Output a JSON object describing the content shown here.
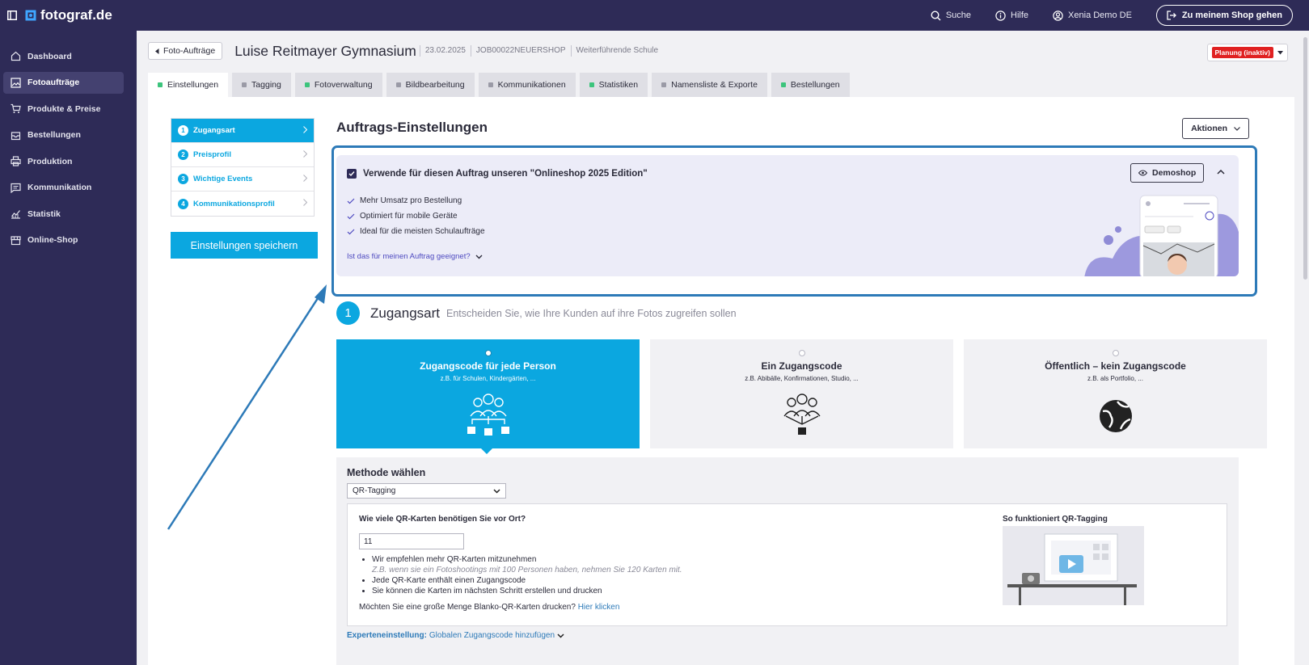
{
  "topbar": {
    "logo": "fotograf.de",
    "search": "Suche",
    "help": "Hilfe",
    "user": "Xenia Demo DE",
    "shop_button": "Zu meinem Shop gehen"
  },
  "sidebar": {
    "items": [
      {
        "label": "Dashboard",
        "icon": "home-icon"
      },
      {
        "label": "Fotoaufträge",
        "icon": "image-icon",
        "active": true
      },
      {
        "label": "Produkte & Preise",
        "icon": "cart-icon"
      },
      {
        "label": "Bestellungen",
        "icon": "inbox-icon"
      },
      {
        "label": "Produktion",
        "icon": "printer-icon"
      },
      {
        "label": "Kommunikation",
        "icon": "message-icon"
      },
      {
        "label": "Statistik",
        "icon": "chart-icon"
      },
      {
        "label": "Online-Shop",
        "icon": "store-icon"
      }
    ]
  },
  "header": {
    "back": "Foto-Aufträge",
    "title": "Luise Reitmayer Gymnasium",
    "date": "23.02.2025",
    "job_id": "JOB00022NEUERSHOP",
    "school_type": "Weiterführende Schule",
    "status": "Planung (inaktiv)"
  },
  "tabs": [
    {
      "label": "Einstellungen",
      "dot": "#3cc47c",
      "active": true
    },
    {
      "label": "Tagging",
      "dot": "#9a9aa6"
    },
    {
      "label": "Fotoverwaltung",
      "dot": "#3cc47c"
    },
    {
      "label": "Bildbearbeitung",
      "dot": "#9a9aa6"
    },
    {
      "label": "Kommunikationen",
      "dot": "#9a9aa6"
    },
    {
      "label": "Statistiken",
      "dot": "#3cc47c"
    },
    {
      "label": "Namensliste & Exporte",
      "dot": "#9a9aa6"
    },
    {
      "label": "Bestellungen",
      "dot": "#3cc47c"
    }
  ],
  "steps": [
    {
      "num": "1",
      "label": "Zugangsart",
      "active": true
    },
    {
      "num": "2",
      "label": "Preisprofil"
    },
    {
      "num": "3",
      "label": "Wichtige Events"
    },
    {
      "num": "4",
      "label": "Kommunikationsprofil"
    }
  ],
  "save_button": "Einstellungen speichern",
  "section_title": "Auftrags-Einstellungen",
  "actions_button": "Aktionen",
  "onlineshop": {
    "checkbox_label": "Verwende für diesen Auftrag unseren \"Onlineshop 2025 Edition\"",
    "features": [
      "Mehr Umsatz pro Bestellung",
      "Optimiert für mobile Geräte",
      "Ideal für die meisten Schulaufträge"
    ],
    "suitable_link": "Ist das für meinen Auftrag geeignet?",
    "demo_button": "Demoshop"
  },
  "zugangsart": {
    "num": "1",
    "title": "Zugangsart",
    "subtitle": "Entscheiden Sie, wie Ihre Kunden auf ihre Fotos zugreifen sollen",
    "cards": [
      {
        "title": "Zugangscode für jede Person",
        "sub": "z.B. für Schulen, Kindergärten, ...",
        "selected": true
      },
      {
        "title": "Ein Zugangscode",
        "sub": "z.B. Abibälle, Konfirmationen, Studio, ..."
      },
      {
        "title": "Öffentlich – kein Zugangscode",
        "sub": "z.B. als Portfolio, ..."
      }
    ]
  },
  "methode": {
    "title": "Methode wählen",
    "selected": "QR-Tagging",
    "question": "Wie viele QR-Karten benötigen Sie vor Ort?",
    "quantity": "11",
    "bullet1": "Wir empfehlen mehr QR-Karten mitzunehmen",
    "example": "Z.B. wenn sie ein Fotoshootings mit 100 Personen haben, nehmen Sie 120 Karten mit.",
    "bullet2": "Jede QR-Karte enthält einen Zugangscode",
    "bullet3": "Sie können die Karten im nächsten Schritt erstellen und drucken",
    "more_text": "Möchten Sie eine große Menge Blanko-QR-Karten drucken?",
    "more_link": "Hier klicken",
    "howto": "So funktioniert QR-Tagging",
    "expert_key": "Experteneinstellung:",
    "expert_value": "Globalen Zugangscode hinzufügen"
  },
  "colors": {
    "primary": "#0ba7e0",
    "navy": "#2e2b57",
    "highlight": "#2d7ab8",
    "status": "#e02121"
  }
}
